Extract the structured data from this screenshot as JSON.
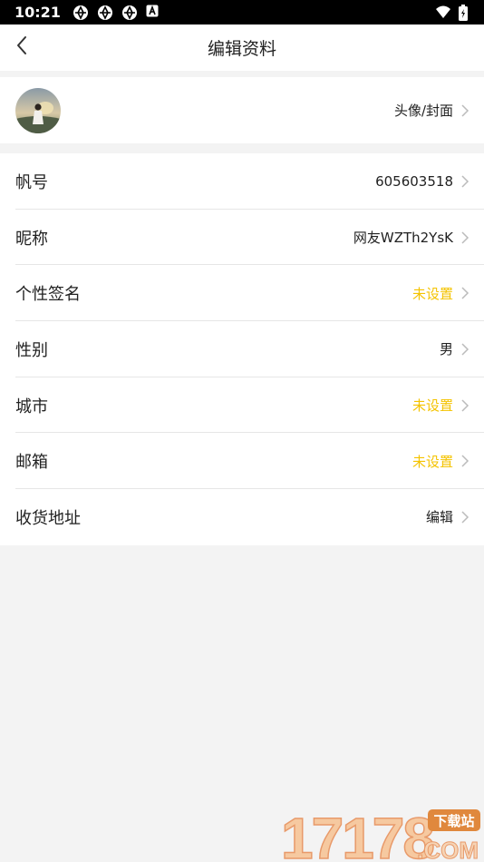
{
  "status_bar": {
    "time": "10:21",
    "icons": [
      "aperture-icon",
      "aperture-icon",
      "aperture-icon",
      "a-badge-icon"
    ],
    "right_icons": [
      "wifi-icon",
      "battery-charging-icon"
    ]
  },
  "header": {
    "title": "编辑资料",
    "back_icon": "chevron-left-icon"
  },
  "profile": {
    "avatar_label": "头像/封面"
  },
  "items": [
    {
      "label": "帆号",
      "value": "605603518",
      "unset": false
    },
    {
      "label": "昵称",
      "value": "网友WZTh2YsK",
      "unset": false
    },
    {
      "label": "个性签名",
      "value": "未设置",
      "unset": true
    },
    {
      "label": "性别",
      "value": "男",
      "unset": false
    },
    {
      "label": "城市",
      "value": "未设置",
      "unset": true
    },
    {
      "label": "邮箱",
      "value": "未设置",
      "unset": true
    },
    {
      "label": "收货地址",
      "value": "编辑",
      "unset": false
    }
  ],
  "watermark": {
    "number": "17178",
    "tag": "下载站",
    "domain": ".COM"
  },
  "colors": {
    "unset": "#f4c300",
    "background": "#f3f3f3",
    "text": "#222222"
  }
}
